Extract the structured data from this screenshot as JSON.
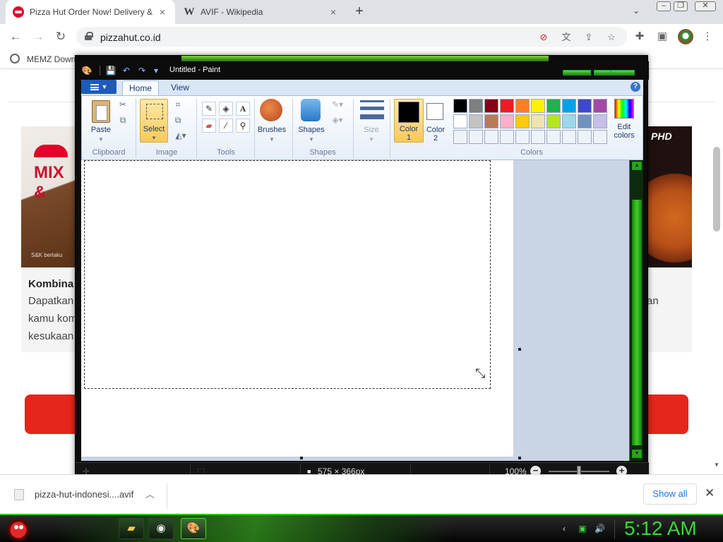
{
  "browser": {
    "tabs": [
      {
        "title": "Pizza Hut Order Now! Delivery &",
        "close": "×"
      },
      {
        "title": "AVIF - Wikipedia",
        "close": "×",
        "favicon_text": "W"
      }
    ],
    "new_tab": "+",
    "url": "pizzahut.co.id",
    "bookmark": "MEMZ Down"
  },
  "webpage": {
    "promo_left_text": "MIX &",
    "promo_left_small": "S&K berlaku",
    "promo_right_text": "PHD",
    "card_title": "Kombina",
    "card_lines": [
      "Dapatkan",
      "kamu kom",
      "kesukaan"
    ],
    "card_right_text": "an"
  },
  "paint": {
    "title": "Untitled - Paint",
    "tabs": [
      "Home",
      "View"
    ],
    "groups": {
      "clipboard": {
        "label": "Clipboard",
        "paste": "Paste"
      },
      "image": {
        "label": "Image",
        "select": "Select"
      },
      "tools": {
        "label": "Tools"
      },
      "brushes": {
        "label": "Brushes"
      },
      "shapes": {
        "label": "Shapes",
        "button": "Shapes"
      },
      "size": {
        "label": "Size"
      },
      "color1": {
        "line1": "Color",
        "line2": "1",
        "value": "#000000"
      },
      "color2": {
        "line1": "Color",
        "line2": "2",
        "value": "#ffffff"
      },
      "colors": {
        "label": "Colors"
      },
      "edit_colors": {
        "line1": "Edit",
        "line2": "colors"
      }
    },
    "palette": [
      "#000000",
      "#7f7f7f",
      "#880015",
      "#ed1c24",
      "#ff7f27",
      "#fff200",
      "#22b14c",
      "#00a2e8",
      "#3f48cc",
      "#a349a4",
      "#ffffff",
      "#c3c3c3",
      "#b97a57",
      "#ffaec9",
      "#ffc90e",
      "#efe4b0",
      "#b5e61d",
      "#99d9ea",
      "#7092be",
      "#c8bfe7",
      "#eef3fa",
      "#eef3fa",
      "#eef3fa",
      "#eef3fa",
      "#eef3fa",
      "#eef3fa",
      "#eef3fa",
      "#eef3fa",
      "#eef3fa",
      "#eef3fa"
    ],
    "status": {
      "selection_size": "575 × 366px",
      "zoom": "100%"
    }
  },
  "downloads": {
    "file": "pizza-hut-indonesi....avif",
    "show_all": "Show all"
  },
  "taskbar": {
    "clock": "5:12 AM"
  }
}
